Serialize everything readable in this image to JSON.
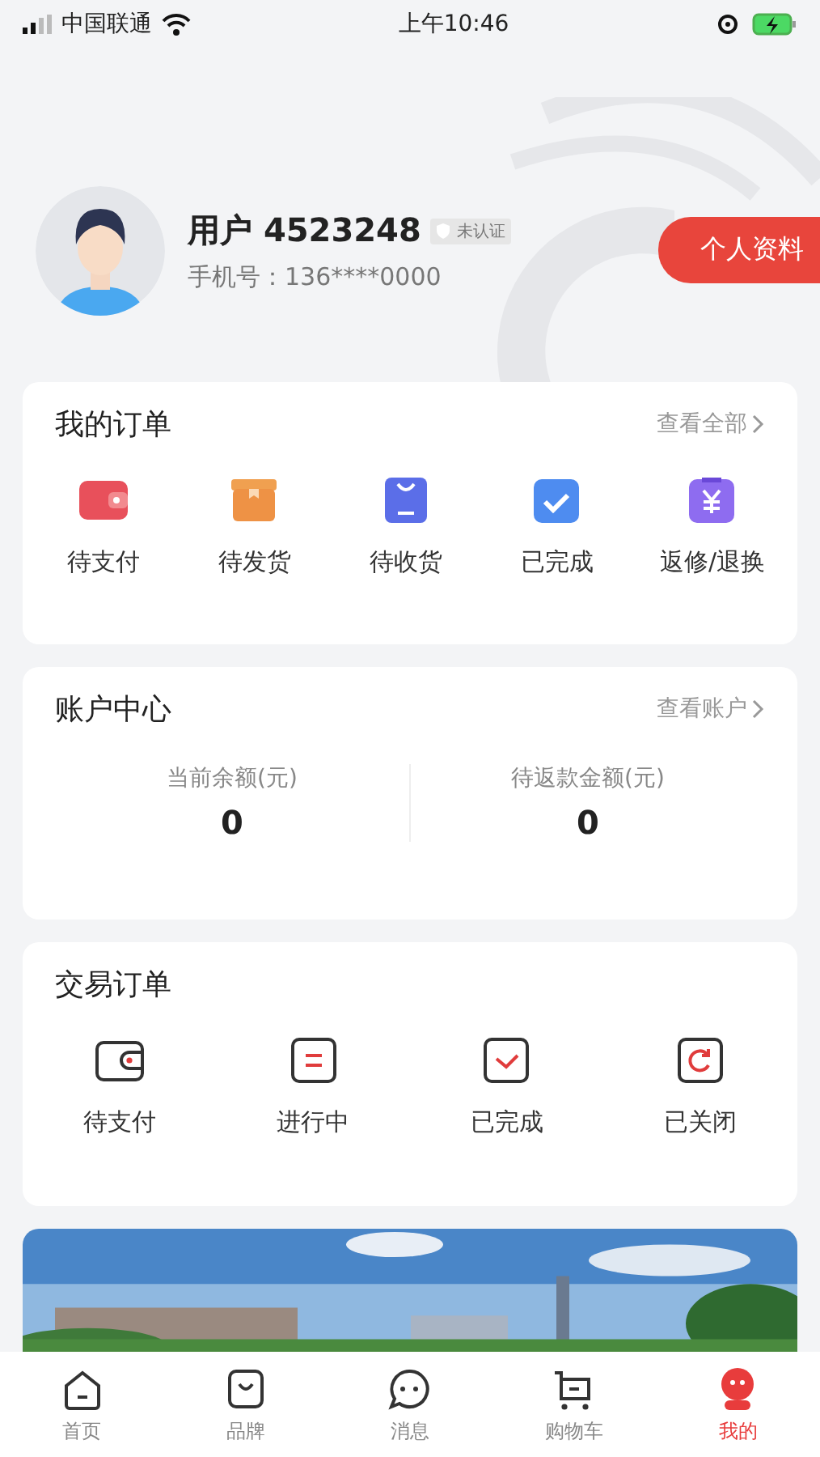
{
  "status_bar": {
    "carrier": "中国联通",
    "time": "上午10:46"
  },
  "profile": {
    "name": "用户 4523248",
    "verify_badge": "未认证",
    "phone": "手机号：136****0000",
    "edit_button": "个人资料"
  },
  "my_orders": {
    "title": "我的订单",
    "link": "查看全部",
    "items": [
      {
        "kind": "wallet",
        "label": "待支付"
      },
      {
        "kind": "box",
        "label": "待发货"
      },
      {
        "kind": "bag",
        "label": "待收货"
      },
      {
        "kind": "check",
        "label": "已完成"
      },
      {
        "kind": "refund",
        "label": "返修/退换"
      }
    ]
  },
  "account": {
    "title": "账户中心",
    "link": "查看账户",
    "stats": [
      {
        "label": "当前余额(元)",
        "value": "0"
      },
      {
        "label": "待返款金额(元)",
        "value": "0"
      }
    ]
  },
  "trade_orders": {
    "title": "交易订单",
    "items": [
      {
        "kind": "wallet",
        "label": "待支付"
      },
      {
        "kind": "progress",
        "label": "进行中"
      },
      {
        "kind": "check",
        "label": "已完成"
      },
      {
        "kind": "closed",
        "label": "已关闭"
      }
    ]
  },
  "tab_bar": [
    {
      "kind": "home",
      "label": "首页",
      "selected": false
    },
    {
      "kind": "brand",
      "label": "品牌",
      "selected": false
    },
    {
      "kind": "message",
      "label": "消息",
      "selected": false
    },
    {
      "kind": "cart",
      "label": "购物车",
      "selected": false
    },
    {
      "kind": "mine",
      "label": "我的",
      "selected": true
    }
  ]
}
